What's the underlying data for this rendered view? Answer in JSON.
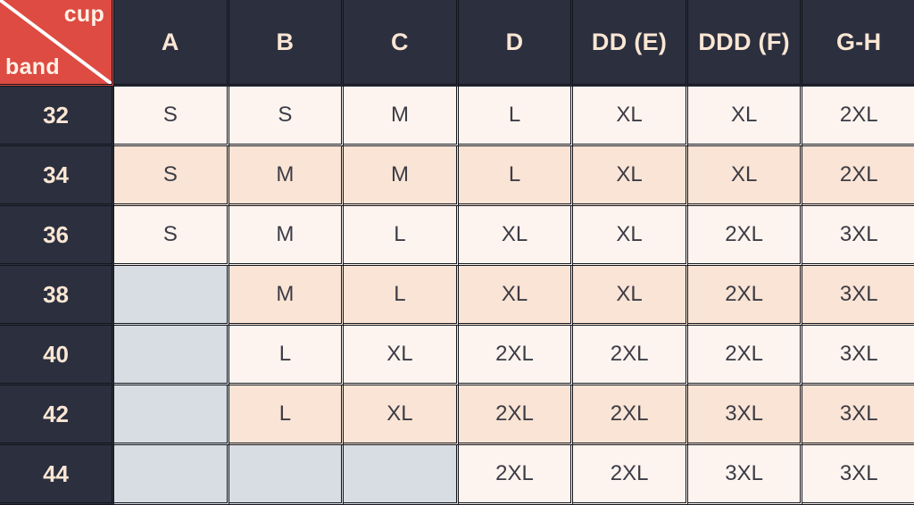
{
  "table": {
    "corner": {
      "cup_label": "cup",
      "band_label": "band",
      "accent_color": "#de4b42",
      "diagonal_color": "#ffffff"
    },
    "cup_headers": [
      "A",
      "B",
      "C",
      "D",
      "DD (E)",
      "DDD (F)",
      "G-H"
    ],
    "band_sizes": [
      "32",
      "34",
      "36",
      "38",
      "40",
      "42",
      "44"
    ],
    "colors": {
      "header_bg": "#2b2f3e",
      "header_text": "#fbe6d4",
      "row_odd_bg": "#fdf4f0",
      "row_even_bg": "#fae4d5",
      "empty_bg": "#d7dde2",
      "cell_text": "#3c3c45",
      "grid_line": "#14161d"
    },
    "rows": [
      {
        "band": "32",
        "sizes": [
          "S",
          "S",
          "M",
          "L",
          "XL",
          "XL",
          "2XL"
        ]
      },
      {
        "band": "34",
        "sizes": [
          "S",
          "M",
          "M",
          "L",
          "XL",
          "XL",
          "2XL"
        ]
      },
      {
        "band": "36",
        "sizes": [
          "S",
          "M",
          "L",
          "XL",
          "XL",
          "2XL",
          "3XL"
        ]
      },
      {
        "band": "38",
        "sizes": [
          "",
          "M",
          "L",
          "XL",
          "XL",
          "2XL",
          "3XL"
        ]
      },
      {
        "band": "40",
        "sizes": [
          "",
          "L",
          "XL",
          "2XL",
          "2XL",
          "2XL",
          "3XL"
        ]
      },
      {
        "band": "42",
        "sizes": [
          "",
          "L",
          "XL",
          "2XL",
          "2XL",
          "3XL",
          "3XL"
        ]
      },
      {
        "band": "44",
        "sizes": [
          "",
          "",
          "",
          "2XL",
          "2XL",
          "3XL",
          "3XL"
        ]
      }
    ]
  }
}
